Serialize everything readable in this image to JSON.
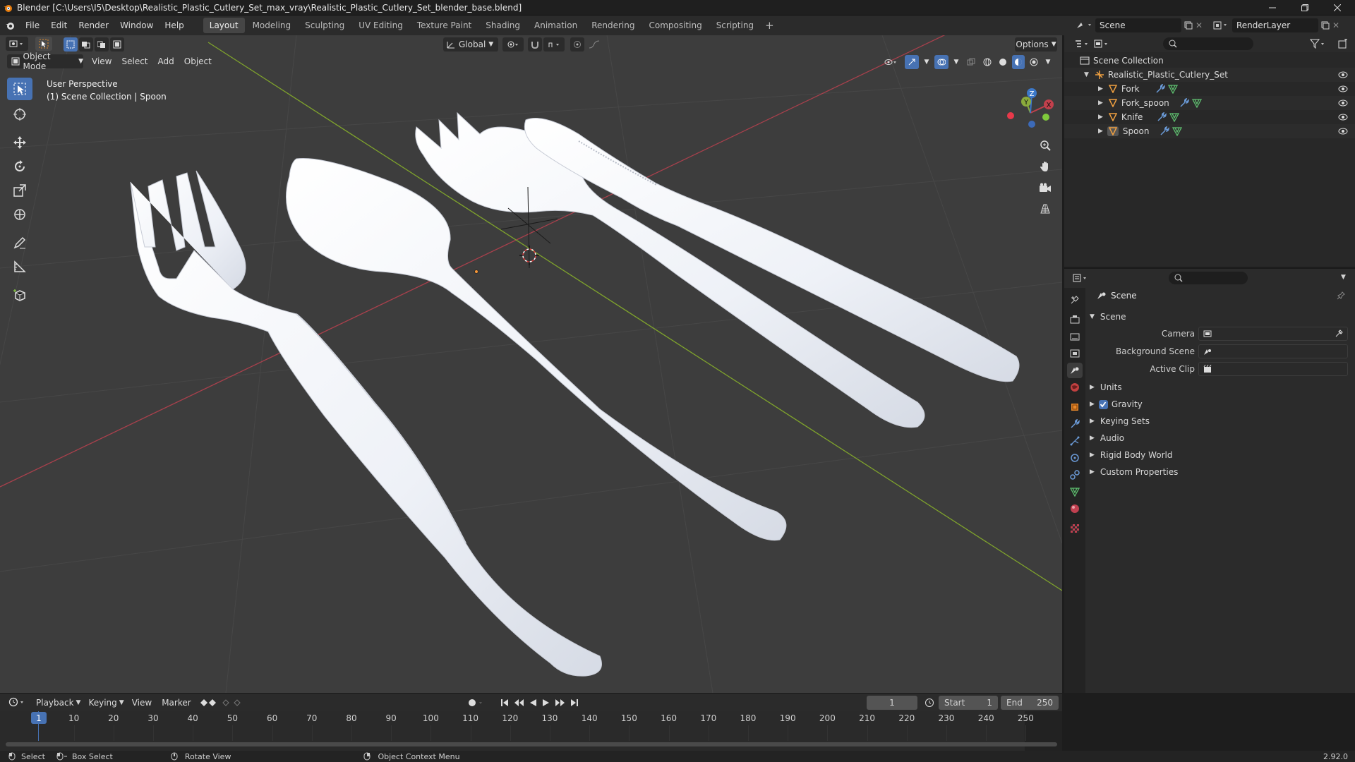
{
  "window": {
    "title": "Blender [C:\\Users\\I5\\Desktop\\Realistic_Plastic_Cutlery_Set_max_vray\\Realistic_Plastic_Cutlery_Set_blender_base.blend]"
  },
  "menus": [
    "File",
    "Edit",
    "Render",
    "Window",
    "Help"
  ],
  "workspace_tabs": [
    "Layout",
    "Modeling",
    "Sculpting",
    "UV Editing",
    "Texture Paint",
    "Shading",
    "Animation",
    "Rendering",
    "Compositing",
    "Scripting"
  ],
  "active_workspace": "Layout",
  "scene_selector": {
    "value": "Scene"
  },
  "view_layer": {
    "value": "RenderLayer"
  },
  "viewport": {
    "mode": "Object Mode",
    "menus": [
      "View",
      "Select",
      "Add",
      "Object"
    ],
    "transform_orientation": "Global",
    "options_label": "Options",
    "overlay_title": "User Perspective",
    "overlay_subtitle": "(1) Scene Collection | Spoon",
    "gizmo": {
      "x": "X",
      "y": "Y",
      "z": "Z"
    },
    "colors": {
      "background": "#3d3d3d",
      "x_axis": "#a8404c",
      "y_axis": "#7fa32c",
      "cutlery": "#f4f6fa"
    }
  },
  "outliner": {
    "root": "Scene Collection",
    "collection": "Realistic_Plastic_Cutlery_Set",
    "objects": [
      "Fork",
      "Fork_spoon",
      "Knife",
      "Spoon"
    ]
  },
  "properties": {
    "context_title": "Scene",
    "panel_title": "Scene",
    "fields": [
      {
        "label": "Camera",
        "value": ""
      },
      {
        "label": "Background Scene",
        "value": ""
      },
      {
        "label": "Active Clip",
        "value": ""
      }
    ],
    "sections": [
      "Units",
      "Gravity",
      "Keying Sets",
      "Audio",
      "Rigid Body World",
      "Custom Properties"
    ],
    "gravity_checked": true
  },
  "timeline": {
    "menus": [
      "Playback",
      "Keying",
      "View",
      "Marker"
    ],
    "current_frame": "1",
    "start_label": "Start",
    "start_value": "1",
    "end_label": "End",
    "end_value": "250",
    "ticks": [
      "10",
      "20",
      "30",
      "40",
      "50",
      "60",
      "70",
      "80",
      "90",
      "100",
      "110",
      "120",
      "130",
      "140",
      "150",
      "160",
      "170",
      "180",
      "190",
      "200",
      "210",
      "220",
      "230",
      "240",
      "250"
    ],
    "playhead_label": "1"
  },
  "statusbar": {
    "items": [
      "Select",
      "Box Select",
      "Rotate View",
      "Object Context Menu"
    ],
    "version": "2.92.0"
  }
}
